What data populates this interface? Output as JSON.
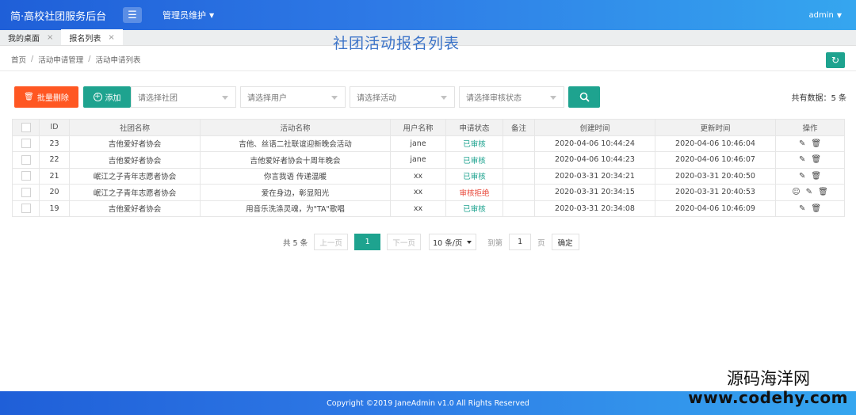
{
  "header": {
    "brand": "简·高校社团服务后台",
    "admin_menu": "管理员维护",
    "user": "admin"
  },
  "tabs": [
    {
      "label": "我的桌面",
      "close": "×"
    },
    {
      "label": "报名列表",
      "close": "×"
    }
  ],
  "page_heading": "社团活动报名列表",
  "breadcrumb": [
    "首页",
    "活动申请管理",
    "活动申请列表"
  ],
  "breadcrumb_sep": "/",
  "toolbar": {
    "batch_delete": "批量删除",
    "add": "添加",
    "select_club": "请选择社团",
    "select_user": "请选择用户",
    "select_activity": "请选择活动",
    "select_status": "请选择审核状态",
    "total": "共有数据：5 条"
  },
  "table": {
    "headers": [
      "ID",
      "社团名称",
      "活动名称",
      "用户名称",
      "申请状态",
      "备注",
      "创建时间",
      "更新时间",
      "操作"
    ],
    "rows": [
      {
        "id": "23",
        "club": "吉他爱好者协会",
        "activity": "吉他、丝语二社联谊迎新晚会活动",
        "user": "jane",
        "status": "已审核",
        "note": "",
        "created": "2020-04-06 10:44:24",
        "updated": "2020-04-06 10:46:04"
      },
      {
        "id": "22",
        "club": "吉他爱好者协会",
        "activity": "吉他爱好者协会十周年晚会",
        "user": "jane",
        "status": "已审核",
        "note": "",
        "created": "2020-04-06 10:44:23",
        "updated": "2020-04-06 10:46:07"
      },
      {
        "id": "21",
        "club": "岷江之子青年志愿者协会",
        "activity": "你言我语 传递温暖",
        "user": "xx",
        "status": "已审核",
        "note": "",
        "created": "2020-03-31 20:34:21",
        "updated": "2020-03-31 20:40:50"
      },
      {
        "id": "20",
        "club": "岷江之子青年志愿者协会",
        "activity": "爱在身边，彰显阳光",
        "user": "xx",
        "status": "审核拒绝",
        "note": "",
        "created": "2020-03-31 20:34:15",
        "updated": "2020-03-31 20:40:53"
      },
      {
        "id": "19",
        "club": "吉他爱好者协会",
        "activity": "用音乐洗涤灵魂，为\"TA\"歌唱",
        "user": "xx",
        "status": "已审核",
        "note": "",
        "created": "2020-03-31 20:34:08",
        "updated": "2020-04-06 10:46:09"
      }
    ]
  },
  "pagination": {
    "total": "共 5 条",
    "prev": "上一页",
    "current": "1",
    "next": "下一页",
    "page_size": "10 条/页",
    "goto_label": "到第",
    "goto_value": "1",
    "page_unit": "页",
    "confirm": "确定"
  },
  "footer": "Copyright ©2019 JaneAdmin v1.0 All Rights Reserved",
  "watermark": {
    "name": "源码海洋网",
    "url": "www.codehy.com"
  },
  "colors": {
    "primary": "#2e7ae6",
    "teal": "#1ea38f",
    "danger": "#ff5722",
    "rejected": "#e8483a"
  }
}
